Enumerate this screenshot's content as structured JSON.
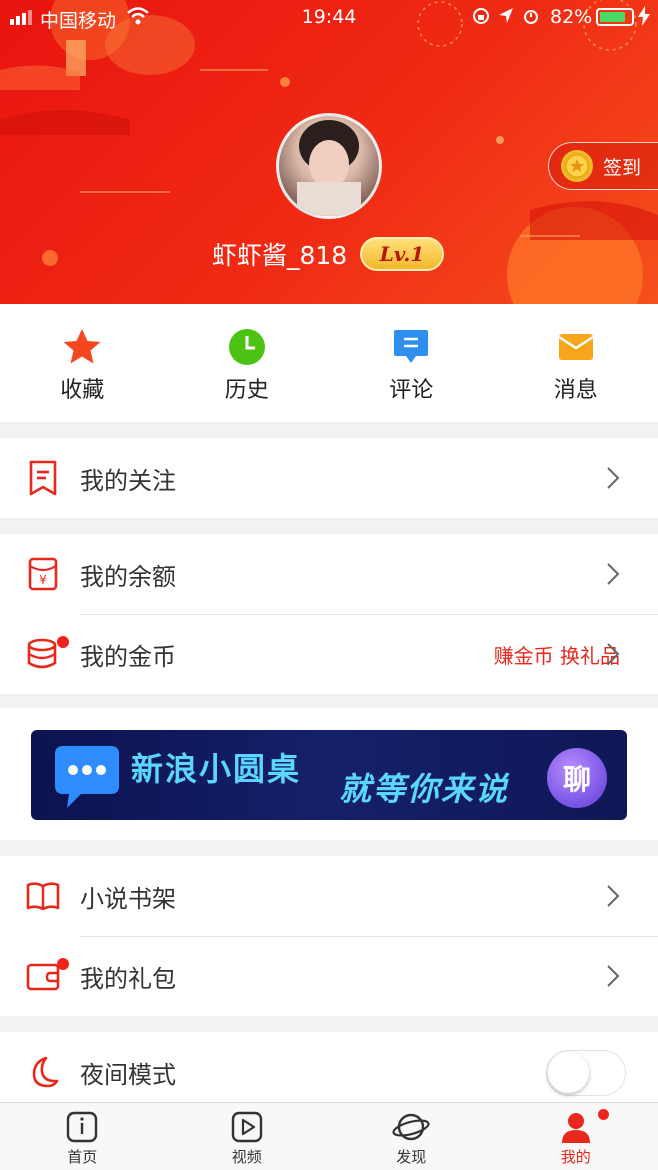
{
  "status_bar": {
    "carrier": "中国移动",
    "time": "19:44",
    "battery": "82%",
    "battery_level": 0.82
  },
  "profile": {
    "username": "虾虾酱_818",
    "level": "Lv.1",
    "signin_label": "签到"
  },
  "quick_actions": [
    {
      "label": "收藏",
      "icon": "star-icon",
      "color": "#f5471d"
    },
    {
      "label": "历史",
      "icon": "clock-icon",
      "color": "#4cc212"
    },
    {
      "label": "评论",
      "icon": "comment-icon",
      "color": "#2e8ff0"
    },
    {
      "label": "消息",
      "icon": "mail-icon",
      "color": "#f7a61a"
    }
  ],
  "menu": {
    "follow": {
      "label": "我的关注"
    },
    "balance": {
      "label": "我的余额"
    },
    "coins": {
      "label": "我的金币",
      "extra": "赚金币 换礼品"
    },
    "bookshelf": {
      "label": "小说书架"
    },
    "gifts": {
      "label": "我的礼包"
    },
    "night_mode": {
      "label": "夜间模式",
      "enabled": false
    }
  },
  "banner": {
    "title": "新浪小圆桌",
    "slogan": "就等你来说",
    "badge": "聊"
  },
  "tabbar": [
    {
      "label": "首页",
      "icon": "home-icon",
      "active": false
    },
    {
      "label": "视频",
      "icon": "play-icon",
      "active": false
    },
    {
      "label": "发现",
      "icon": "planet-icon",
      "active": false
    },
    {
      "label": "我的",
      "icon": "profile-icon",
      "active": true
    }
  ],
  "colors": {
    "accent": "#e8281c",
    "header_red": "#f02a14"
  }
}
